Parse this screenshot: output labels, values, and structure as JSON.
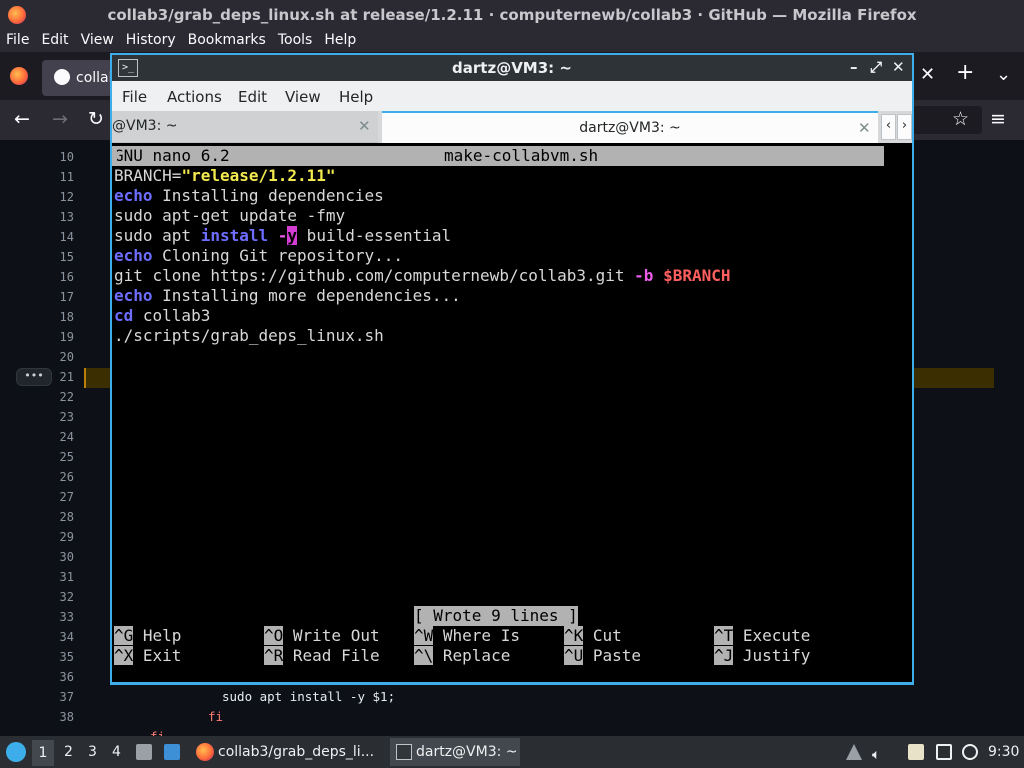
{
  "firefox": {
    "window_title": "collab3/grab_deps_linux.sh at release/1.2.11 · computernewb/collab3 · GitHub — Mozilla Firefox",
    "menu": [
      "File",
      "Edit",
      "View",
      "History",
      "Bookmarks",
      "Tools",
      "Help"
    ],
    "tab_title": "collab",
    "code_view": {
      "line_numbers": [
        "10",
        "11",
        "12",
        "13",
        "14",
        "15",
        "16",
        "17",
        "18",
        "19",
        "20",
        "21",
        "22",
        "23",
        "24",
        "25",
        "26",
        "27",
        "28",
        "29",
        "30",
        "31",
        "32",
        "33",
        "34",
        "35",
        "36",
        "37",
        "38"
      ],
      "visible_code": [
        "sudo apt install -y $1;",
        "fi",
        "fi"
      ],
      "expand_button": "•••"
    }
  },
  "terminal": {
    "window_title": "dartz@VM3: ~",
    "menu": [
      "File",
      "Actions",
      "Edit",
      "View",
      "Help"
    ],
    "tabs": [
      {
        "label": "@VM3: ~",
        "active": false
      },
      {
        "label": "dartz@VM3: ~",
        "active": true
      }
    ],
    "nano": {
      "version": "GNU nano 6.2",
      "filename": "make-collabvm.sh",
      "lines": {
        "l1_a": "BRANCH=",
        "l1_b": "\"release/1.2.11\"",
        "l2_a": "echo",
        "l2_b": " Installing dependencies",
        "l3": "sudo apt-get update -fmy",
        "l4_a": "sudo apt ",
        "l4_b": "install",
        "l4_c": " -",
        "l4_d": "y",
        "l4_e": " build-essential",
        "l5_a": "echo",
        "l5_b": " Cloning Git repository...",
        "l6_a": "git clone https://github.com/computernewb/collab3.git ",
        "l6_b": "-b",
        "l6_c": " ",
        "l6_d": "$BRANCH",
        "l7_a": "echo",
        "l7_b": " Installing more dependencies...",
        "l8_a": "cd",
        "l8_b": " collab3",
        "l9": "./scripts/grab_deps_linux.sh"
      },
      "status": "[ Wrote 9 lines ]",
      "shortcuts_row1": [
        {
          "key": "^G",
          "label": " Help"
        },
        {
          "key": "^O",
          "label": " Write Out"
        },
        {
          "key": "^W",
          "label": " Where Is"
        },
        {
          "key": "^K",
          "label": " Cut"
        },
        {
          "key": "^T",
          "label": " Execute"
        }
      ],
      "shortcuts_row2": [
        {
          "key": "^X",
          "label": " Exit"
        },
        {
          "key": "^R",
          "label": " Read File"
        },
        {
          "key": "^\\",
          "label": " Replace"
        },
        {
          "key": "^U",
          "label": " Paste"
        },
        {
          "key": "^J",
          "label": " Justify"
        }
      ]
    }
  },
  "taskbar": {
    "workspaces": [
      "1",
      "2",
      "3",
      "4"
    ],
    "tasks": [
      {
        "label": "collab3/grab_deps_li...",
        "icon": "firefox-icon"
      },
      {
        "label": "dartz@VM3: ~",
        "icon": "terminal-icon"
      }
    ],
    "clock": "9:30"
  }
}
